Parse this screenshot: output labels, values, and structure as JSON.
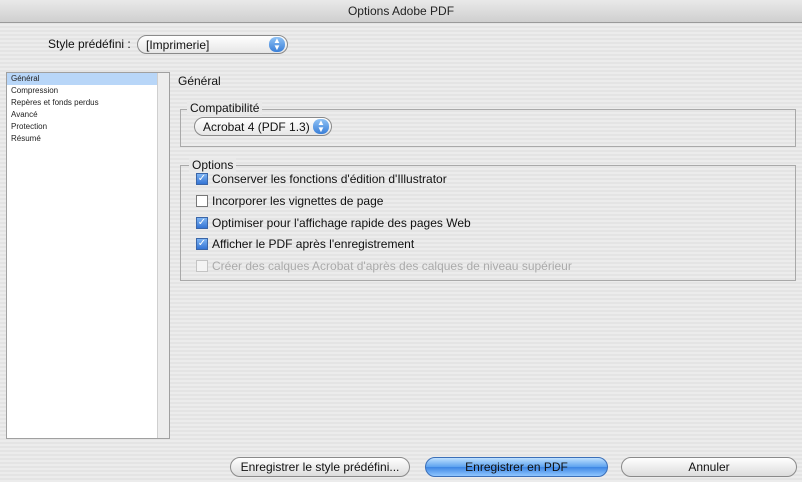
{
  "window": {
    "title": "Options Adobe PDF"
  },
  "preset": {
    "label": "Style prédéfini :",
    "value": "[Imprimerie]"
  },
  "sidebar": {
    "items": [
      {
        "label": "Général",
        "selected": true
      },
      {
        "label": "Compression",
        "selected": false
      },
      {
        "label": "Repères et fonds perdus",
        "selected": false
      },
      {
        "label": "Avancé",
        "selected": false
      },
      {
        "label": "Protection",
        "selected": false
      },
      {
        "label": "Résumé",
        "selected": false
      }
    ]
  },
  "main": {
    "section_title": "Général",
    "compat": {
      "title": "Compatibilité",
      "value": "Acrobat 4 (PDF 1.3)"
    },
    "options": {
      "title": "Options",
      "items": [
        {
          "label": "Conserver les fonctions d'édition d'Illustrator",
          "checked": true,
          "enabled": true
        },
        {
          "label": "Incorporer les vignettes de page",
          "checked": false,
          "enabled": true
        },
        {
          "label": "Optimiser pour l'affichage rapide des pages Web",
          "checked": true,
          "enabled": true
        },
        {
          "label": "Afficher le PDF après l'enregistrement",
          "checked": true,
          "enabled": true
        },
        {
          "label": "Créer des calques Acrobat d'après des calques de niveau supérieur",
          "checked": false,
          "enabled": false
        }
      ]
    }
  },
  "buttons": {
    "save_preset": "Enregistrer le style prédéfini...",
    "save_pdf": "Enregistrer en PDF",
    "cancel": "Annuler"
  },
  "colors": {
    "accent": "#3d86e4",
    "selection": "#b8d6f8"
  }
}
